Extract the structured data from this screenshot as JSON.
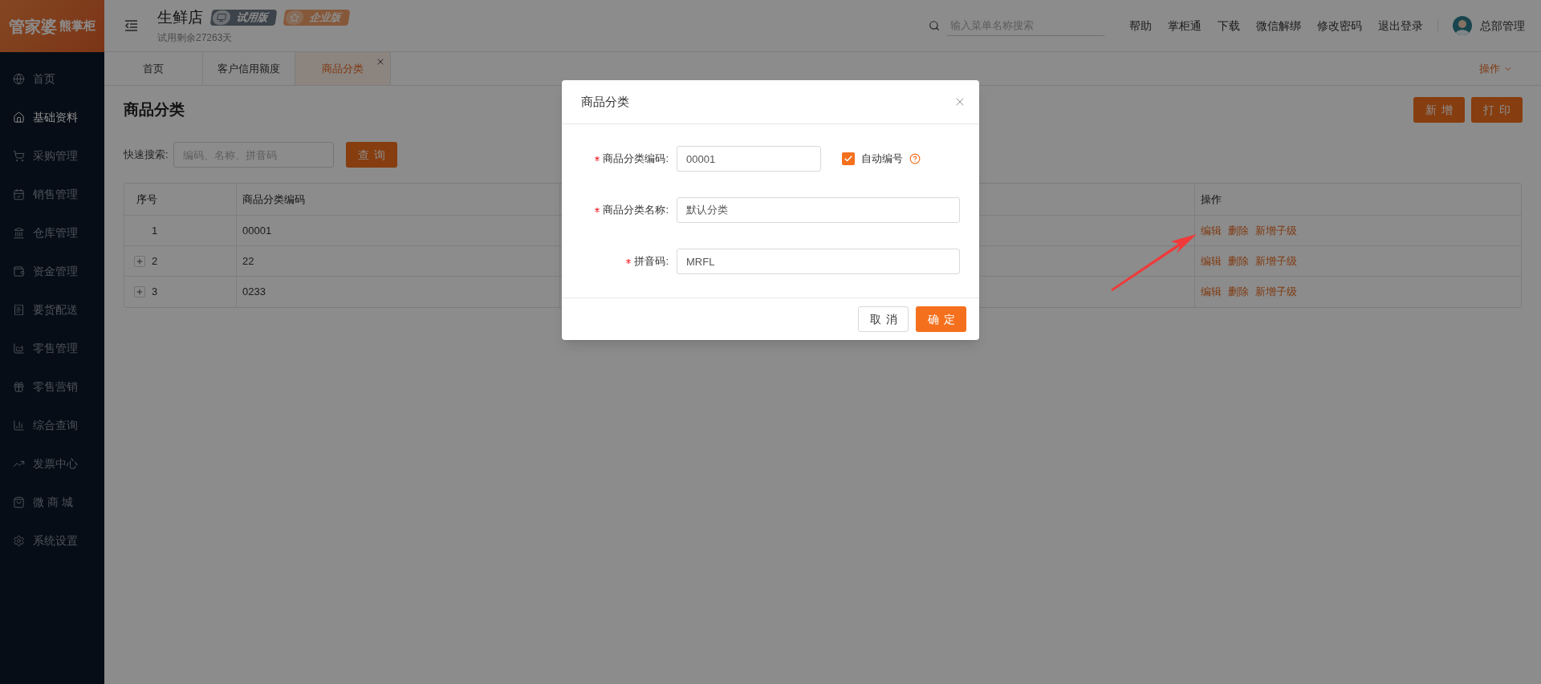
{
  "logo": {
    "brand": "管家婆",
    "product": "熊掌柜"
  },
  "sidebar": {
    "items": [
      {
        "label": "首页",
        "selected": false
      },
      {
        "label": "基础资料",
        "selected": true
      },
      {
        "label": "采购管理",
        "selected": false
      },
      {
        "label": "销售管理",
        "selected": false
      },
      {
        "label": "仓库管理",
        "selected": false
      },
      {
        "label": "资金管理",
        "selected": false
      },
      {
        "label": "要货配送",
        "selected": false
      },
      {
        "label": "零售管理",
        "selected": false
      },
      {
        "label": "零售营销",
        "selected": false
      },
      {
        "label": "综合查询",
        "selected": false
      },
      {
        "label": "发票中心",
        "selected": false
      },
      {
        "label": "微 商 城",
        "selected": false
      },
      {
        "label": "系统设置",
        "selected": false
      }
    ]
  },
  "header": {
    "store_name": "生鲜店",
    "badges": [
      {
        "label": "试用版",
        "kind": "trial"
      },
      {
        "label": "企业版",
        "kind": "enterprise"
      }
    ],
    "trial_note": "试用剩余27263天",
    "search": {
      "placeholder": "输入菜单名称搜索"
    },
    "links": [
      "帮助",
      "掌柜通",
      "下载",
      "微信解绑",
      "修改密码",
      "退出登录"
    ],
    "user": "总部管理"
  },
  "tabs": {
    "items": [
      {
        "label": "首页",
        "selected": false
      },
      {
        "label": "客户信用额度",
        "selected": false
      },
      {
        "label": "商品分类",
        "selected": true
      }
    ],
    "actions_menu": "操作"
  },
  "page": {
    "title": "商品分类",
    "buttons": [
      "新增",
      "打印"
    ],
    "quick_search": {
      "label": "快速搜索:",
      "placeholder": "编码、名称、拼音码"
    },
    "query_button": "查询"
  },
  "table": {
    "columns": [
      "序号",
      "商品分类编码",
      "操作"
    ],
    "rows": [
      {
        "index": "1",
        "code": "00001",
        "expandable": false,
        "actions": [
          "编辑",
          "删除",
          "新增子级"
        ]
      },
      {
        "index": "2",
        "code": "22",
        "expandable": true,
        "actions": [
          "编辑",
          "删除",
          "新增子级"
        ]
      },
      {
        "index": "3",
        "code": "0233",
        "expandable": true,
        "actions": [
          "编辑",
          "删除",
          "新增子级"
        ]
      }
    ]
  },
  "modal": {
    "title": "商品分类",
    "fields": [
      {
        "label": "商品分类编码:",
        "required": true,
        "value": "00001"
      },
      {
        "label": "商品分类名称:",
        "required": true,
        "value": "默认分类"
      },
      {
        "label": "拼音码:",
        "required": true,
        "value": "MRFL"
      }
    ],
    "auto_number": {
      "label": "自动编号",
      "checked": true
    },
    "buttons": [
      {
        "label": "取消",
        "kind": "secondary"
      },
      {
        "label": "确定",
        "kind": "primary"
      }
    ]
  }
}
